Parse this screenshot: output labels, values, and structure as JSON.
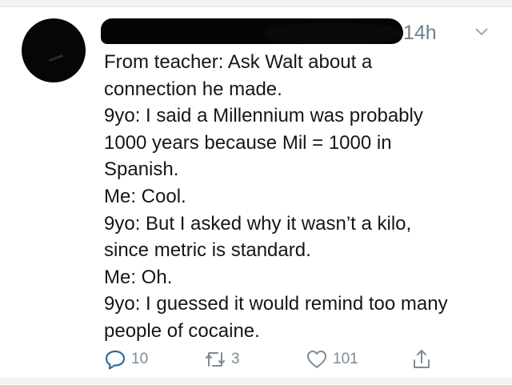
{
  "tweet": {
    "timestamp": "14h",
    "lines": [
      "From teacher: Ask Walt about a",
      "connection he made.",
      "9yo: I said a Millennium was probably",
      "1000 years because Mil = 1000 in",
      "Spanish.",
      "Me: Cool.",
      "9yo: But I asked why it wasn’t a kilo,",
      "since metric is standard.",
      "Me: Oh.",
      "9yo: I guessed it would remind too many",
      "people of cocaine."
    ],
    "actions": {
      "reply_count": "10",
      "retweet_count": "3",
      "like_count": "101"
    }
  },
  "icons": {
    "reply": "reply-icon",
    "retweet": "retweet-icon",
    "like": "heart-icon",
    "share": "share-icon",
    "menu": "chevron-down-icon"
  },
  "colors": {
    "text": "#14171a",
    "muted": "#6e7f8a",
    "redaction": "#050505"
  }
}
